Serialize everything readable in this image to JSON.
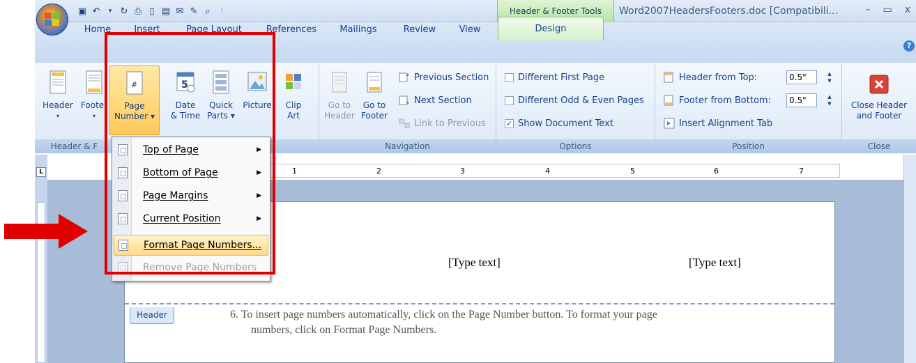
{
  "title_bar": {
    "contextual_tab_group": "Header & Footer Tools",
    "document_title": "Word2007HeadersFooters.doc [Compatibili...",
    "minimize": "–",
    "restore": "▭",
    "close": "x"
  },
  "tabs": [
    {
      "label": "Home"
    },
    {
      "label": "Insert"
    },
    {
      "label": "Page Layout"
    },
    {
      "label": "References"
    },
    {
      "label": "Mailings"
    },
    {
      "label": "Review"
    },
    {
      "label": "View"
    },
    {
      "label": "Design",
      "active": true
    }
  ],
  "ribbon": {
    "header_footer_group": {
      "label": "Header & F",
      "header_btn": "Header",
      "footer_btn": "Footer",
      "page_number_btn_l1": "Page",
      "page_number_btn_l2": "Number ▾"
    },
    "insert_group": {
      "date_time_l1": "Date",
      "date_time_l2": "& Time",
      "quick_parts_l1": "Quick",
      "quick_parts_l2": "Parts ▾",
      "picture": "Picture",
      "clip_art_l1": "Clip",
      "clip_art_l2": "Art"
    },
    "navigation_group": {
      "label": "Navigation",
      "goto_header_l1": "Go to",
      "goto_header_l2": "Header",
      "goto_footer_l1": "Go to",
      "goto_footer_l2": "Footer",
      "previous_section": "Previous Section",
      "next_section": "Next Section",
      "link_to_previous": "Link to Previous"
    },
    "options_group": {
      "label": "Options",
      "different_first_page": "Different First Page",
      "different_odd_even": "Different Odd & Even Pages",
      "show_document_text": "Show Document Text",
      "show_document_text_checked": "✓"
    },
    "position_group": {
      "label": "Position",
      "header_from_top": "Header from Top:",
      "header_from_top_value": "0.5\"",
      "footer_from_bottom": "Footer from Bottom:",
      "footer_from_bottom_value": "0.5\"",
      "insert_alignment_tab": "Insert Alignment Tab"
    },
    "close_group": {
      "label": "Close",
      "close_header_l1": "Close Header",
      "close_header_l2": "and Footer"
    }
  },
  "ruler": {
    "tab_selector": "L",
    "numbers": [
      "1",
      "2",
      "3",
      "4",
      "5",
      "6",
      "7"
    ]
  },
  "page_number_menu": {
    "items": [
      {
        "label": "Top of Page",
        "submenu": true
      },
      {
        "label": "Bottom of Page",
        "submenu": true
      },
      {
        "label": "Page Margins",
        "submenu": true
      },
      {
        "label": "Current Position",
        "submenu": true
      },
      {
        "label": "Format Page Numbers...",
        "highlighted": true
      },
      {
        "label": "Remove Page Numbers",
        "disabled": true
      }
    ],
    "submenu_arrow": "▶"
  },
  "document": {
    "header_placeholder_1": "[Type text]",
    "header_placeholder_2": "[Type text]",
    "header_tab": "Header",
    "instruction_line1": "6. To insert page numbers automatically, click on the Page Number button.  To format your page",
    "instruction_line2": "numbers, click on Format Page Numbers."
  },
  "help": "?",
  "colors": {
    "ribbon_text": "#15428b",
    "contextual_green": "#b6e3a2",
    "highlight_box": "#e00000",
    "menu_hover": "#ffd98a"
  }
}
